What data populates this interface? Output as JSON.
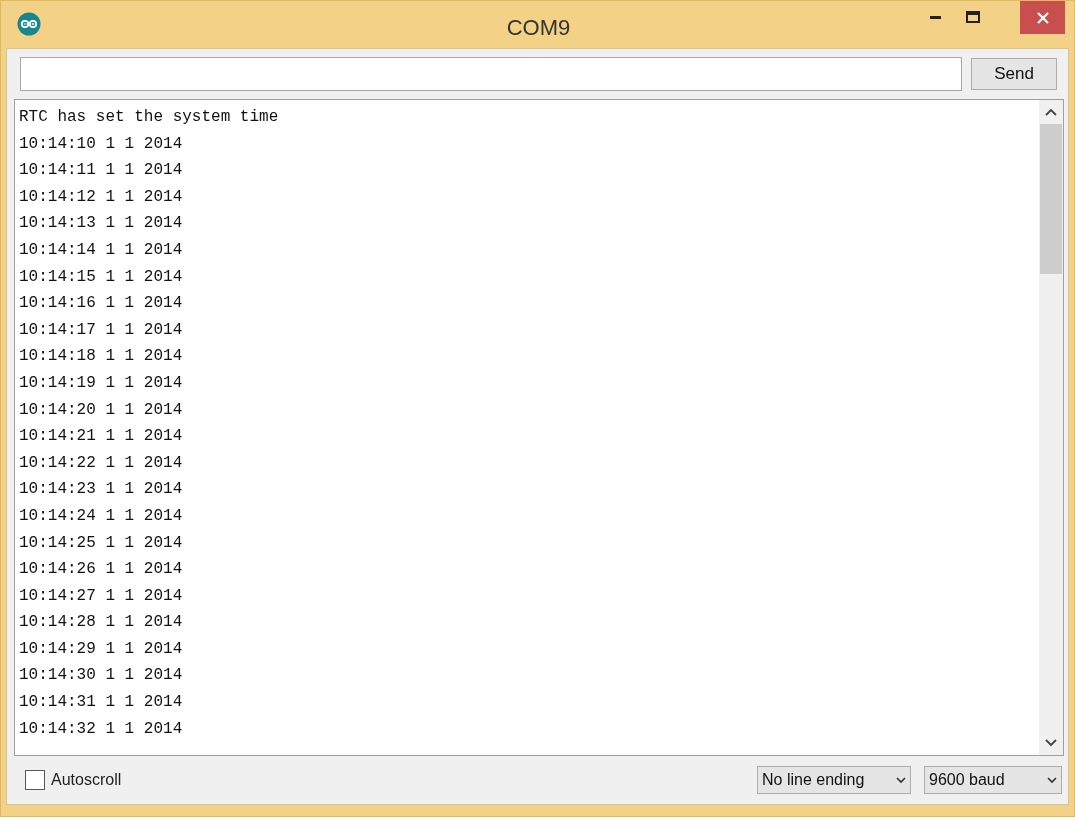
{
  "window": {
    "title": "COM9"
  },
  "send_button": "Send",
  "output_lines": [
    "RTC has set the system time",
    "10:14:10 1 1 2014",
    "10:14:11 1 1 2014",
    "10:14:12 1 1 2014",
    "10:14:13 1 1 2014",
    "10:14:14 1 1 2014",
    "10:14:15 1 1 2014",
    "10:14:16 1 1 2014",
    "10:14:17 1 1 2014",
    "10:14:18 1 1 2014",
    "10:14:19 1 1 2014",
    "10:14:20 1 1 2014",
    "10:14:21 1 1 2014",
    "10:14:22 1 1 2014",
    "10:14:23 1 1 2014",
    "10:14:24 1 1 2014",
    "10:14:25 1 1 2014",
    "10:14:26 1 1 2014",
    "10:14:27 1 1 2014",
    "10:14:28 1 1 2014",
    "10:14:29 1 1 2014",
    "10:14:30 1 1 2014",
    "10:14:31 1 1 2014",
    "10:14:32 1 1 2014"
  ],
  "autoscroll": {
    "label": "Autoscroll",
    "checked": false
  },
  "line_ending": "No line ending",
  "baud_rate": "9600 baud"
}
